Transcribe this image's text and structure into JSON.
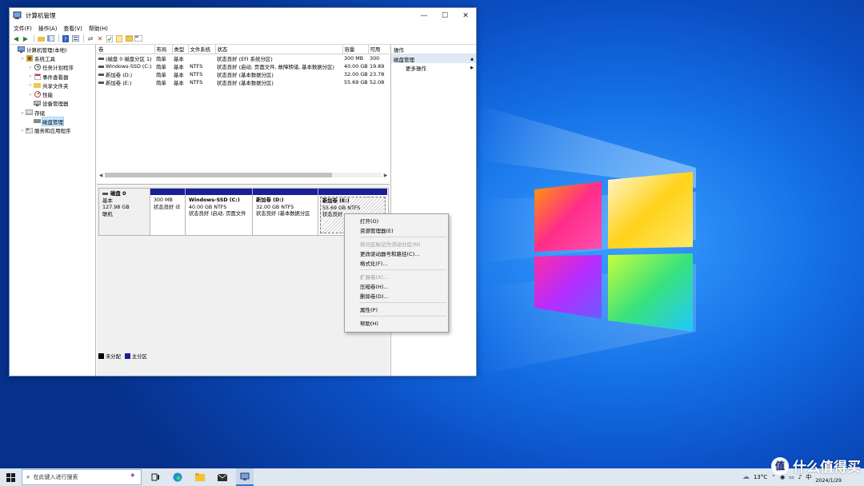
{
  "window": {
    "title": "计算机管理",
    "controls": {
      "minimize": "—",
      "maximize": "☐",
      "close": "✕"
    }
  },
  "menu": [
    "文件(F)",
    "操作(A)",
    "查看(V)",
    "帮助(H)"
  ],
  "tree": [
    {
      "label": "计算机管理(本地)",
      "indent": 0,
      "exp": "",
      "icon": "computer-icon"
    },
    {
      "label": "系统工具",
      "indent": 1,
      "exp": "⌄",
      "icon": "tools-icon"
    },
    {
      "label": "任务计划程序",
      "indent": 2,
      "exp": "›",
      "icon": "clock-icon"
    },
    {
      "label": "事件查看器",
      "indent": 2,
      "exp": "›",
      "icon": "event-icon"
    },
    {
      "label": "共享文件夹",
      "indent": 2,
      "exp": "›",
      "icon": "folder-icon"
    },
    {
      "label": "性能",
      "indent": 2,
      "exp": "›",
      "icon": "performance-icon"
    },
    {
      "label": "设备管理器",
      "indent": 2,
      "exp": "",
      "icon": "device-icon"
    },
    {
      "label": "存储",
      "indent": 1,
      "exp": "⌄",
      "icon": "storage-icon"
    },
    {
      "label": "磁盘管理",
      "indent": 2,
      "exp": "",
      "icon": "disk-icon",
      "selected": true
    },
    {
      "label": "服务和应用程序",
      "indent": 1,
      "exp": "›",
      "icon": "services-icon"
    }
  ],
  "volumes": {
    "headers": [
      "卷",
      "布局",
      "类型",
      "文件系统",
      "状态",
      "容量",
      "可用"
    ],
    "rows": [
      [
        "(磁盘 0 磁盘分区 1)",
        "简单",
        "基本",
        "",
        "状态良好 (EFI 系统分区)",
        "300 MB",
        "300"
      ],
      [
        "Windows-SSD (C:)",
        "简单",
        "基本",
        "NTFS",
        "状态良好 (启动, 页面文件, 故障转储, 基本数据分区)",
        "40.00 GB",
        "19.89"
      ],
      [
        "新加卷 (D:)",
        "简单",
        "基本",
        "NTFS",
        "状态良好 (基本数据分区)",
        "32.00 GB",
        "23.78"
      ],
      [
        "新加卷 (E:)",
        "简单",
        "基本",
        "NTFS",
        "状态良好 (基本数据分区)",
        "55.69 GB",
        "52.08"
      ]
    ]
  },
  "disk": {
    "name": "磁盘 0",
    "type": "基本",
    "size": "127.98 GB",
    "status": "联机",
    "partitions": [
      {
        "title": "",
        "size": "300 MB",
        "status": "状态良好 (E"
      },
      {
        "title": "Windows-SSD  (C:)",
        "size": "40.00 GB NTFS",
        "status": "状态良好 (启动, 页面文件"
      },
      {
        "title": "新加卷  (D:)",
        "size": "32.00 GB NTFS",
        "status": "状态良好 (基本数据分区"
      },
      {
        "title": "新加卷  (E:)",
        "size": "55.69 GB NTFS",
        "status": "状态良好"
      }
    ]
  },
  "legend": [
    {
      "label": "未分配",
      "color": "#000000"
    },
    {
      "label": "主分区",
      "color": "#1a1f9a"
    }
  ],
  "actions": {
    "header": "操作",
    "section": "磁盘管理",
    "more": "更多操作"
  },
  "context_menu": [
    {
      "label": "打开(O)",
      "disabled": false
    },
    {
      "label": "资源管理器(E)",
      "disabled": false
    },
    {
      "sep": true
    },
    {
      "label": "将分区标记为活动分区(M)",
      "disabled": true
    },
    {
      "label": "更改驱动器号和路径(C)...",
      "disabled": false
    },
    {
      "label": "格式化(F)...",
      "disabled": false
    },
    {
      "sep": true
    },
    {
      "label": "扩展卷(X)...",
      "disabled": true
    },
    {
      "label": "压缩卷(H)...",
      "disabled": false
    },
    {
      "label": "删除卷(D)...",
      "disabled": false
    },
    {
      "sep": true
    },
    {
      "label": "属性(P)",
      "disabled": false
    },
    {
      "sep": true
    },
    {
      "label": "帮助(H)",
      "disabled": false
    }
  ],
  "taskbar": {
    "search_placeholder": "在此键入进行搜索",
    "weather": "13°C",
    "ime": "中",
    "date": "2024/1/29"
  },
  "watermark": {
    "logo": "值",
    "text": "什么值得买"
  },
  "colors": {
    "primary_partition": "#1a1f9a",
    "selection": "#cce8ff",
    "accent": "#3a74c8"
  }
}
